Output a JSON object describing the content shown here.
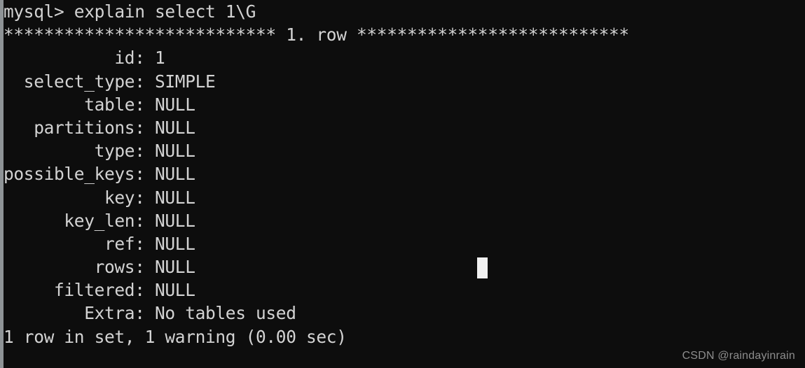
{
  "terminal": {
    "background_color": "#0d0d0d",
    "foreground_color": "#d3d3d3",
    "gutter_color": "#8e9396",
    "cursor_color": "#f0f0f0",
    "prompt": "mysql>",
    "command": "explain select 1\\G",
    "prompt_line": "mysql> explain select 1\\G",
    "row_separator": "*************************** 1. row ***************************",
    "result_fields": [
      {
        "name": "id",
        "value": "1"
      },
      {
        "name": "select_type",
        "value": "SIMPLE"
      },
      {
        "name": "table",
        "value": "NULL"
      },
      {
        "name": "partitions",
        "value": "NULL"
      },
      {
        "name": "type",
        "value": "NULL"
      },
      {
        "name": "possible_keys",
        "value": "NULL"
      },
      {
        "name": "key",
        "value": "NULL"
      },
      {
        "name": "key_len",
        "value": "NULL"
      },
      {
        "name": "ref",
        "value": "NULL"
      },
      {
        "name": "rows",
        "value": "NULL"
      },
      {
        "name": "filtered",
        "value": "NULL"
      },
      {
        "name": "Extra",
        "value": "No tables used"
      }
    ],
    "lines": [
      "mysql> explain select 1\\G",
      "*************************** 1. row ***************************",
      "           id: 1",
      "  select_type: SIMPLE",
      "        table: NULL",
      "   partitions: NULL",
      "         type: NULL",
      "possible_keys: NULL",
      "          key: NULL",
      "      key_len: NULL",
      "          ref: NULL",
      "         rows: NULL",
      "     filtered: NULL",
      "        Extra: No tables used",
      "1 row in set, 1 warning (0.00 sec)"
    ],
    "status_line": "1 row in set, 1 warning (0.00 sec)",
    "row_count": "1 row",
    "warning_count": "1 warning",
    "elapsed": "0.00 sec"
  },
  "watermark": {
    "text": "CSDN @raindayinrain"
  }
}
